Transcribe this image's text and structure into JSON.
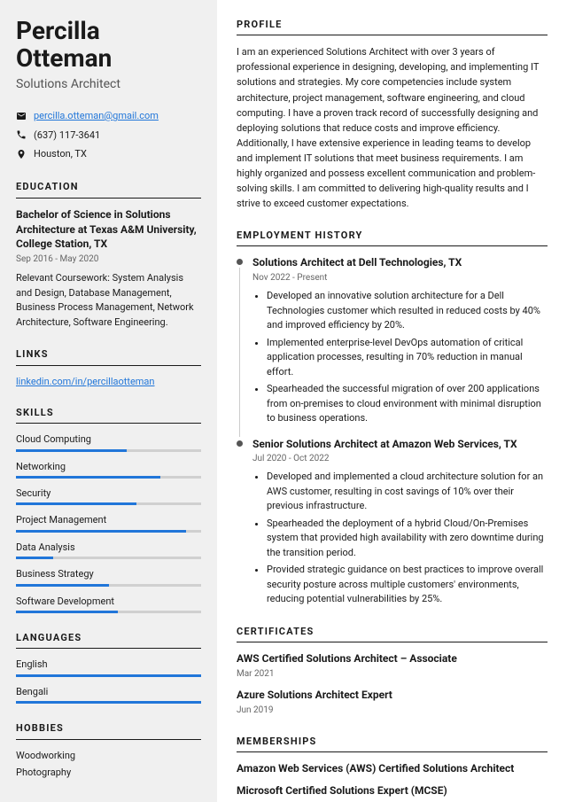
{
  "name": "Percilla Otteman",
  "title": "Solutions Architect",
  "contact": {
    "email": "percilla.otteman@gmail.com",
    "phone": "(637) 117-3641",
    "location": "Houston, TX"
  },
  "education": {
    "heading": "EDUCATION",
    "degree": "Bachelor of Science in Solutions Architecture at Texas A&M University, College Station, TX",
    "dates": "Sep 2016 - May 2020",
    "desc": "Relevant Coursework: System Analysis and Design, Database Management, Business Process Management, Network Architecture, Software Engineering."
  },
  "links": {
    "heading": "LINKS",
    "items": [
      "linkedin.com/in/percillaotteman"
    ]
  },
  "skills": {
    "heading": "SKILLS",
    "items": [
      {
        "name": "Cloud Computing",
        "pct": 60
      },
      {
        "name": "Networking",
        "pct": 78
      },
      {
        "name": "Security",
        "pct": 65
      },
      {
        "name": "Project Management",
        "pct": 92
      },
      {
        "name": "Data Analysis",
        "pct": 20
      },
      {
        "name": "Business Strategy",
        "pct": 50
      },
      {
        "name": "Software Development",
        "pct": 55
      }
    ]
  },
  "languages": {
    "heading": "LANGUAGES",
    "items": [
      {
        "name": "English",
        "pct": 100
      },
      {
        "name": "Bengali",
        "pct": 100
      }
    ]
  },
  "hobbies": {
    "heading": "HOBBIES",
    "items": [
      "Woodworking",
      "Photography"
    ]
  },
  "profile": {
    "heading": "PROFILE",
    "text": "I am an experienced Solutions Architect with over 3 years of professional experience in designing, developing, and implementing IT solutions and strategies. My core competencies include system architecture, project management, software engineering, and cloud computing. I have a proven track record of successfully designing and deploying solutions that reduce costs and improve efficiency. Additionally, I have extensive experience in leading teams to develop and implement IT solutions that meet business requirements. I am highly organized and possess excellent communication and problem-solving skills. I am committed to delivering high-quality results and I strive to exceed customer expectations."
  },
  "employment": {
    "heading": "EMPLOYMENT HISTORY",
    "jobs": [
      {
        "title": "Solutions Architect at Dell Technologies, TX",
        "dates": "Nov 2022 - Present",
        "bullets": [
          "Developed an innovative solution architecture for a Dell Technologies customer which resulted in reduced costs by 40% and improved efficiency by 20%.",
          "Implemented enterprise-level DevOps automation of critical application processes, resulting in 70% reduction in manual effort.",
          "Spearheaded the successful migration of over 200 applications from on-premises to cloud environment with minimal disruption to business operations."
        ]
      },
      {
        "title": "Senior Solutions Architect at Amazon Web Services, TX",
        "dates": "Jul 2020 - Oct 2022",
        "bullets": [
          "Developed and implemented a cloud architecture solution for an AWS customer, resulting in cost savings of 10% over their previous infrastructure.",
          "Spearheaded the deployment of a hybrid Cloud/On-Premises system that provided high availability with zero downtime during the transition period.",
          "Provided strategic guidance on best practices to improve overall security posture across multiple customers' environments, reducing potential vulnerabilities by 25%."
        ]
      }
    ]
  },
  "certificates": {
    "heading": "CERTIFICATES",
    "items": [
      {
        "name": "AWS Certified Solutions Architect – Associate",
        "date": "Mar 2021"
      },
      {
        "name": "Azure Solutions Architect Expert",
        "date": "Jun 2019"
      }
    ]
  },
  "memberships": {
    "heading": "MEMBERSHIPS",
    "items": [
      "Amazon Web Services (AWS) Certified Solutions Architect",
      "Microsoft Certified Solutions Expert (MCSE)"
    ]
  }
}
